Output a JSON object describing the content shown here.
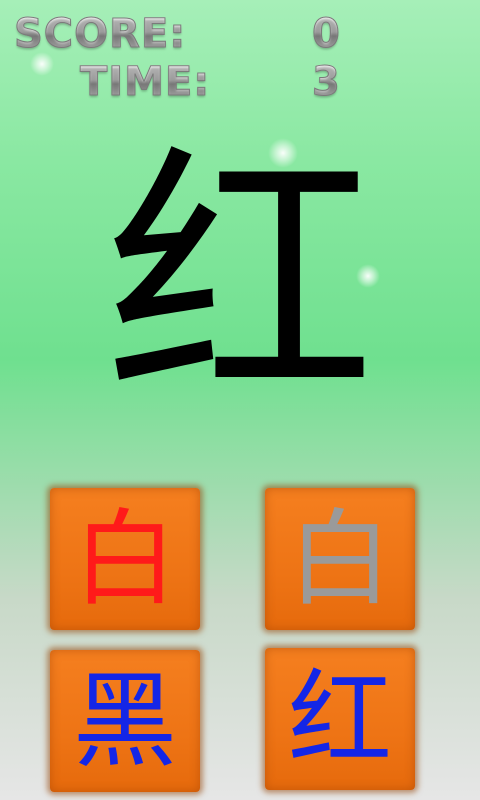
{
  "hud": {
    "score_label": "SCORE:",
    "score_value": "0",
    "time_label": "TIME:",
    "time_value": "3"
  },
  "prompt": {
    "character": "红"
  },
  "choices": [
    {
      "character": "白",
      "color": "#ff1a1a"
    },
    {
      "character": "白",
      "color": "#9a9a9a"
    },
    {
      "character": "黑",
      "color": "#1426e6"
    },
    {
      "character": "红",
      "color": "#1426e6"
    }
  ],
  "colors": {
    "tile": "#ee7415",
    "prompt_text": "#000000"
  }
}
